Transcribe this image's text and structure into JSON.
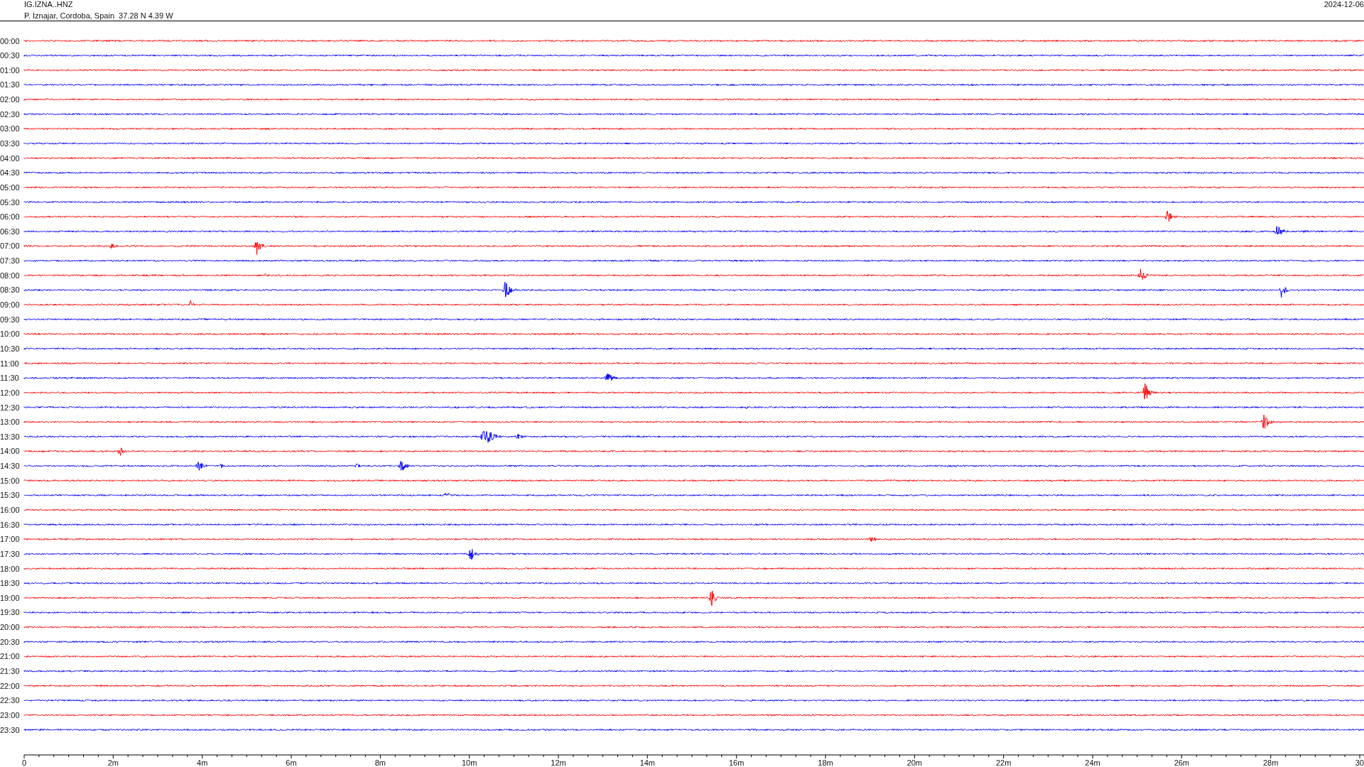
{
  "header": {
    "station": "IG.IZNA..HNZ",
    "location": "P. Iznajar, Cordoba, Spain  37.28 N 4.39 W",
    "date": "2024-12-06"
  },
  "rows": [
    {
      "label": "00:00",
      "color": "#ff0000"
    },
    {
      "label": "00:30",
      "color": "#0000ff"
    },
    {
      "label": "01:00",
      "color": "#ff0000"
    },
    {
      "label": "01:30",
      "color": "#0000ff"
    },
    {
      "label": "02:00",
      "color": "#ff0000"
    },
    {
      "label": "02:30",
      "color": "#0000ff"
    },
    {
      "label": "03:00",
      "color": "#ff0000"
    },
    {
      "label": "03:30",
      "color": "#0000ff"
    },
    {
      "label": "04:00",
      "color": "#ff0000"
    },
    {
      "label": "04:30",
      "color": "#0000ff"
    },
    {
      "label": "05:00",
      "color": "#ff0000"
    },
    {
      "label": "05:30",
      "color": "#0000ff"
    },
    {
      "label": "06:00",
      "color": "#ff0000"
    },
    {
      "label": "06:30",
      "color": "#0000ff"
    },
    {
      "label": "07:00",
      "color": "#ff0000"
    },
    {
      "label": "07:30",
      "color": "#0000ff"
    },
    {
      "label": "08:00",
      "color": "#ff0000"
    },
    {
      "label": "08:30",
      "color": "#0000ff"
    },
    {
      "label": "09:00",
      "color": "#ff0000"
    },
    {
      "label": "09:30",
      "color": "#0000ff"
    },
    {
      "label": "10:00",
      "color": "#ff0000"
    },
    {
      "label": "10:30",
      "color": "#0000ff"
    },
    {
      "label": "11:00",
      "color": "#ff0000"
    },
    {
      "label": "11:30",
      "color": "#0000ff"
    },
    {
      "label": "12:00",
      "color": "#ff0000"
    },
    {
      "label": "12:30",
      "color": "#0000ff"
    },
    {
      "label": "13:00",
      "color": "#ff0000"
    },
    {
      "label": "13:30",
      "color": "#0000ff"
    },
    {
      "label": "14:00",
      "color": "#ff0000"
    },
    {
      "label": "14:30",
      "color": "#0000ff"
    },
    {
      "label": "15:00",
      "color": "#ff0000"
    },
    {
      "label": "15:30",
      "color": "#0000ff"
    },
    {
      "label": "16:00",
      "color": "#ff0000"
    },
    {
      "label": "16:30",
      "color": "#0000ff"
    },
    {
      "label": "17:00",
      "color": "#ff0000"
    },
    {
      "label": "17:30",
      "color": "#0000ff"
    },
    {
      "label": "18:00",
      "color": "#ff0000"
    },
    {
      "label": "18:30",
      "color": "#0000ff"
    },
    {
      "label": "19:00",
      "color": "#ff0000"
    },
    {
      "label": "19:30",
      "color": "#0000ff"
    },
    {
      "label": "20:00",
      "color": "#ff0000"
    },
    {
      "label": "20:30",
      "color": "#0000ff"
    },
    {
      "label": "21:00",
      "color": "#ff0000"
    },
    {
      "label": "21:30",
      "color": "#0000ff"
    },
    {
      "label": "22:00",
      "color": "#ff0000"
    },
    {
      "label": "22:30",
      "color": "#0000ff"
    },
    {
      "label": "23:00",
      "color": "#ff0000"
    },
    {
      "label": "23:30",
      "color": "#0000ff"
    }
  ],
  "axis": {
    "labels": [
      "0",
      "2m",
      "4m",
      "6m",
      "8m",
      "10m",
      "12m",
      "14m",
      "16m",
      "18m",
      "20m",
      "22m",
      "24m",
      "26m",
      "28m",
      "30"
    ]
  }
}
